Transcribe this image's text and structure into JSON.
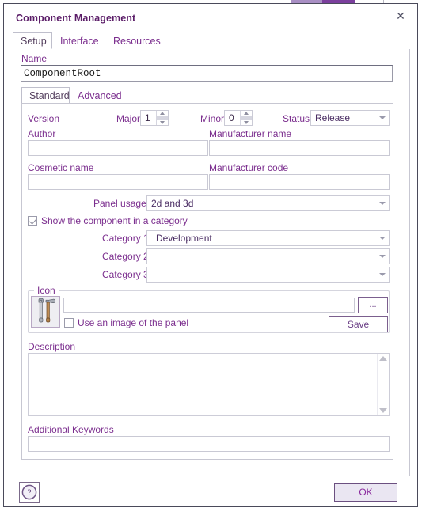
{
  "window": {
    "title": "Component Management",
    "close_label": "✕"
  },
  "outer_tabs": [
    {
      "label": "Setup",
      "selected": true
    },
    {
      "label": "Interface",
      "selected": false
    },
    {
      "label": "Resources",
      "selected": false
    }
  ],
  "name_field": {
    "label": "Name",
    "value": "ComponentRoot"
  },
  "inner_tabs": [
    {
      "label": "Standard",
      "selected": true
    },
    {
      "label": "Advanced",
      "selected": false
    }
  ],
  "version": {
    "label": "Version",
    "major_label": "Major",
    "major_value": "1",
    "minor_label": "Minor",
    "minor_value": "0",
    "status_label": "Status",
    "status_value": "Release"
  },
  "author": {
    "label": "Author",
    "value": ""
  },
  "manufacturer_name": {
    "label": "Manufacturer name",
    "value": ""
  },
  "cosmetic_name": {
    "label": "Cosmetic name",
    "value": ""
  },
  "manufacturer_code": {
    "label": "Manufacturer code",
    "value": ""
  },
  "panel_usage": {
    "label": "Panel usage:",
    "value": "2d and 3d"
  },
  "show_category": {
    "label": "Show the component in a category",
    "checked": true
  },
  "categories": [
    {
      "label": "Category 1",
      "value": "Development"
    },
    {
      "label": "Category 2",
      "value": ""
    },
    {
      "label": "Category 3",
      "value": ""
    }
  ],
  "icon_group": {
    "title": "Icon",
    "preview_icon": "tools-wrench-hammer-icon",
    "path_value": "",
    "browse_label": "...",
    "use_panel_image_label": "Use an image of the panel",
    "use_panel_image_checked": false,
    "save_label": "Save"
  },
  "description": {
    "label": "Description",
    "value": ""
  },
  "keywords": {
    "label": "Additional Keywords",
    "value": ""
  },
  "footer": {
    "help_icon": "question-mark-circle-icon",
    "ok_label": "OK"
  },
  "colors": {
    "title_text": "#5b1d68",
    "label_text": "#7b2e8e",
    "accent_button": "#8a2a9e",
    "ok_button_bg": "#eae6f2",
    "border": "#c7c7d2"
  }
}
